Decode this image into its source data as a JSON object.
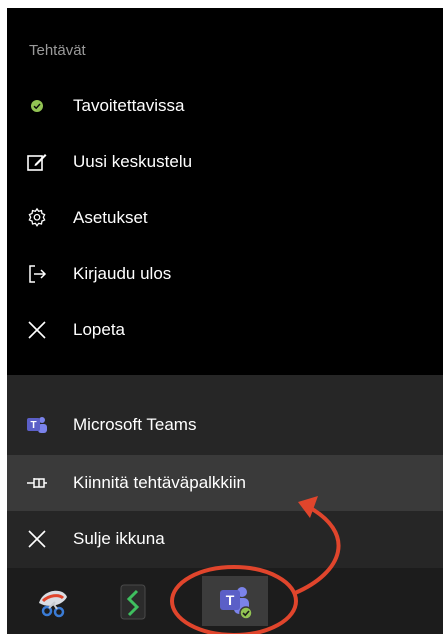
{
  "menu": {
    "section_title": "Tehtävät",
    "items": [
      {
        "label": "Tavoitettavissa",
        "icon": "status-available-icon"
      },
      {
        "label": "Uusi keskustelu",
        "icon": "new-chat-icon"
      },
      {
        "label": "Asetukset",
        "icon": "gear-icon"
      },
      {
        "label": "Kirjaudu ulos",
        "icon": "sign-out-icon"
      },
      {
        "label": "Lopeta",
        "icon": "close-icon"
      }
    ]
  },
  "jumplist": {
    "items": [
      {
        "label": "Microsoft Teams",
        "icon": "teams-icon"
      },
      {
        "label": "Kiinnitä tehtäväpalkkiin",
        "icon": "pin-icon"
      },
      {
        "label": "Sulje ikkuna",
        "icon": "close-icon"
      }
    ]
  },
  "taskbar": {
    "apps": [
      {
        "icon": "snipping-tool-icon"
      },
      {
        "icon": "green-app-icon"
      },
      {
        "icon": "teams-taskbar-icon",
        "active": true
      }
    ]
  },
  "colors": {
    "menu_bg": "#000000",
    "lower_bg": "#262626",
    "highlight": "#3a3a3a",
    "annotation": "#e0452c",
    "status_green": "#92c353",
    "teams_purple": "#5b5fc7"
  }
}
